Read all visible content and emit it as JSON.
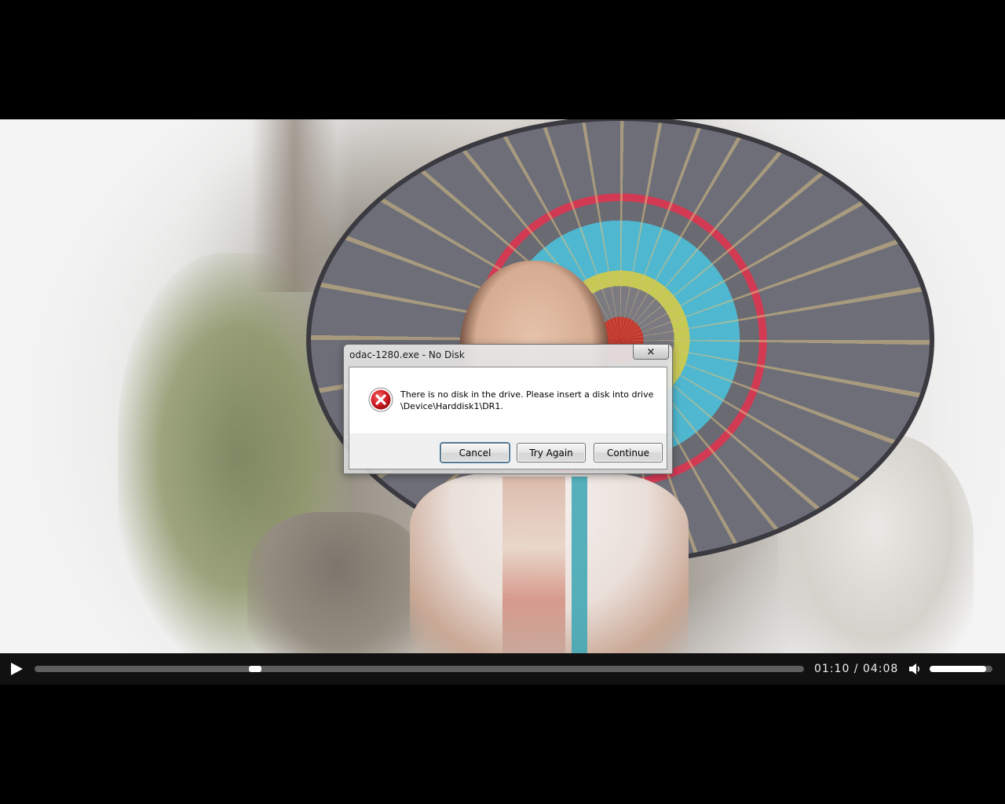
{
  "dialog": {
    "title": "odac-1280.exe - No Disk",
    "close_label": "×",
    "icon": "error-icon",
    "message_line1": "There is no disk in the drive. Please insert a disk into drive",
    "message_line2": "\\Device\\Harddisk1\\DR1.",
    "buttons": {
      "cancel": "Cancel",
      "try_again": "Try Again",
      "continue": "Continue"
    }
  },
  "player": {
    "time_display": "01:10 / 04:08",
    "progress_fraction": 0.2868,
    "volume_fraction": 0.9,
    "icons": {
      "play": "play-icon",
      "volume": "speaker-icon"
    }
  },
  "colors": {
    "error_red": "#d41f26",
    "control_bar": "#141414",
    "track": "#5e5e5e",
    "thumb": "#ffffff"
  }
}
